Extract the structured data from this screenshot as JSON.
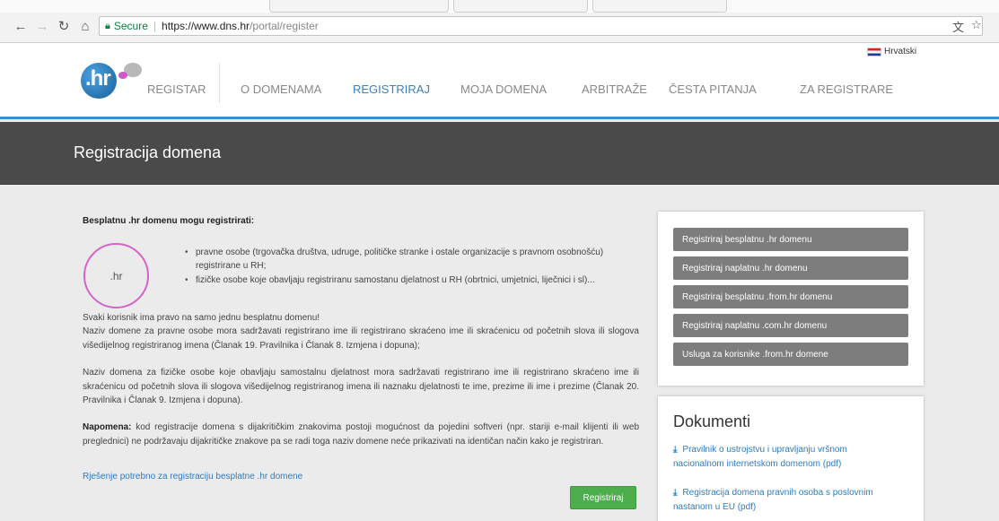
{
  "browser": {
    "secure_label": "Secure",
    "url_host": "https://www.dns.hr",
    "url_path": "/portal/register",
    "icons": [
      "back-arrow-icon",
      "forward-arrow-icon",
      "reload-icon",
      "home-icon",
      "lock-icon",
      "translate-icon",
      "star-icon"
    ]
  },
  "header": {
    "language": "Hrvatski",
    "logo_text": ".hr",
    "nav": [
      {
        "label": "REGISTAR",
        "active": false
      },
      {
        "label": "O DOMENAMA",
        "active": false
      },
      {
        "label": "REGISTRIRAJ",
        "active": true
      },
      {
        "label": "MOJA DOMENA",
        "active": false
      },
      {
        "label": "ARBITRAŽE",
        "active": false
      },
      {
        "label": "ČESTA PITANJA",
        "active": false
      },
      {
        "label": "ZA REGISTRARE",
        "active": false
      }
    ]
  },
  "banner": {
    "title": "Registracija domena"
  },
  "main": {
    "lead": "Besplatnu .hr domenu mogu registrirati:",
    "badge": ".hr",
    "bullets": [
      "pravne osobe (trgovačka društva, udruge, političke stranke i ostale organizacije s pravnom osobnošću) registrirane u RH;",
      "fizičke osobe koje obavljaju registriranu samostanu djelatnost u RH (obrtnici, umjetnici, liječnici i sl)..."
    ],
    "para1": "Svaki korisnik ima pravo na samo jednu besplatnu domenu!",
    "para2": "Naziv domene za pravne osobe mora sadržavati registrirano ime ili registrirano skraćeno ime ili skraćenicu od početnih slova ili slogova višedijelnog registriranog imena (Članak 19. Pravilnika i Članak 8. Izmjena i dopuna);",
    "para3": "Naziv domena za fizičke osobe koje obavljaju samostalnu djelatnost mora sadržavati registrirano ime ili registrirano skraćeno ime ili skraćenicu od početnih slova ili slogova višedijelnog registriranog imena ili naznaku djelatnosti te ime, prezime ili ime i prezime (Članak 20. Pravilnika i Članak 9. Izmjena i dopuna).",
    "note_label": "Napomena:",
    "note_text": " kod registracije domena s dijakritičkim znakovima postoji mogućnost da pojedini softveri (npr. stariji e-mail klijenti ili web preglednici) ne podržavaju dijakritičke znakove pa se radi toga naziv domene neće prikazivati na identičan način kako je registriran.",
    "link": "Rješenje potrebno za registraciju besplatne .hr domene",
    "register_button": "Registriraj"
  },
  "sidebar": {
    "buttons": [
      "Registriraj besplatnu .hr domenu",
      "Registriraj naplatnu .hr domenu",
      "Registriraj besplatnu .from.hr domenu",
      "Registriraj naplatnu .com.hr domenu",
      "Usluga za korisnike .from.hr domene"
    ],
    "docs_title": "Dokumenti",
    "docs": [
      "Pravilnik o ustrojstvu i upravljanju vršnom nacionalnom internetskom domenom (pdf)",
      "Registracija domena pravnih osoba s poslovnim nastanom u EU (pdf)"
    ]
  }
}
